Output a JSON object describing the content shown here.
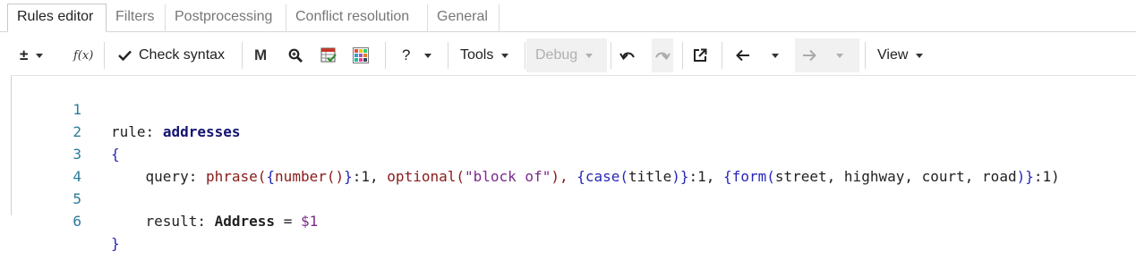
{
  "tabs": [
    {
      "label": "Rules editor",
      "active": true
    },
    {
      "label": "Filters"
    },
    {
      "label": "Postprocessing"
    },
    {
      "label": "Conflict resolution"
    },
    {
      "label": "General"
    }
  ],
  "toolbar": {
    "plus_minus_symbol": "±",
    "fx_symbol": "f(x)",
    "check_syntax_label": "Check syntax",
    "m_symbol": "M",
    "help_symbol": "?",
    "tools_label": "Tools",
    "debug_label": "Debug",
    "view_label": "View"
  },
  "editor": {
    "line_numbers": [
      "1",
      "2",
      "3",
      "4",
      "5",
      "6"
    ],
    "line1": {
      "keyword": "rule:",
      "name": "addresses"
    },
    "line2": {
      "brace": "{"
    },
    "line3": {
      "key": "query:",
      "phrase": "phrase(",
      "b1_open": "{",
      "number": "number()",
      "b1_close": "}",
      "w1": ":1,",
      "optional": "optional(",
      "opt_str": "\"block of\"",
      "opt_close": "),",
      "b2_open": "{",
      "case_fn": "case(",
      "case_arg": "title",
      "case_close": ")",
      "b2_close": "}",
      "w2": ":1,",
      "b3_open": "{",
      "form_fn": "form(",
      "form_args": "street, highway, court, road",
      "form_close": ")",
      "b3_close": "}",
      "w3": ":1)"
    },
    "line5": {
      "key": "result:",
      "type": "Address",
      "eq": "=",
      "ref": "$1"
    },
    "line6": {
      "brace": "}"
    }
  },
  "colors": {
    "keyword": "#222222",
    "rule_name": "#141470",
    "function": "#8a1a1a",
    "brace": "#2626b8",
    "string": "#7a2a8a",
    "line_number": "#2d7a9a"
  }
}
